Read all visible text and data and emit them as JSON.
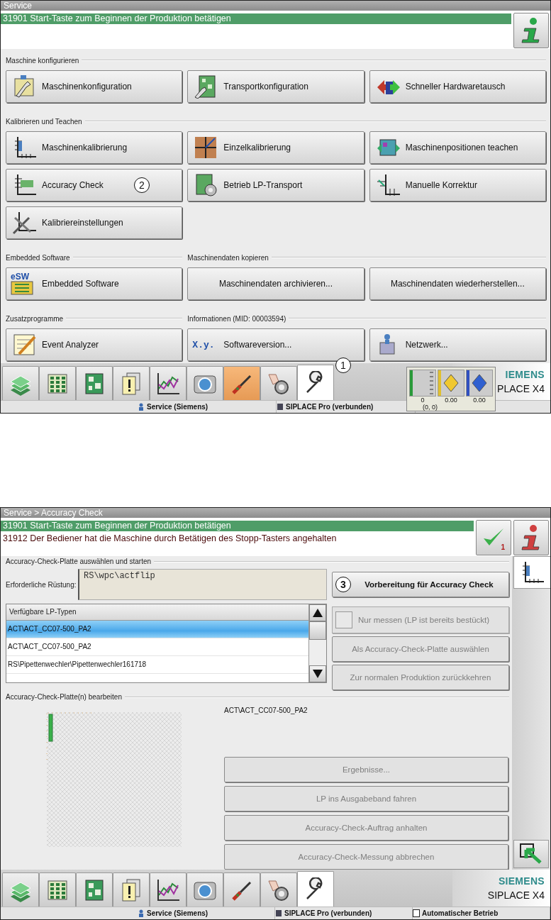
{
  "service_screen": {
    "title": "Service",
    "messages": [
      {
        "text": "31901 Start-Taste zum Beginnen der Produktion betätigen",
        "highlighted": true
      }
    ],
    "group_rows": [
      {
        "groups": [
          {
            "label": "Maschine konfigurieren",
            "buttons": [
              {
                "label": "Maschinenkonfiguration",
                "kind": "icon"
              },
              {
                "label": "Transportkonfiguration",
                "kind": "icon"
              },
              {
                "label": "Schneller Hardwaretausch",
                "kind": "icon"
              }
            ]
          }
        ]
      },
      {
        "groups": [
          {
            "label": "Kalibrieren und Teachen",
            "buttons": [
              {
                "label": "Maschinenkalibrierung",
                "kind": "icon"
              },
              {
                "label": "Einzelkalibrierung",
                "kind": "icon"
              },
              {
                "label": "Maschinenpositionen teachen",
                "kind": "icon"
              },
              {
                "label": "Accuracy Check",
                "kind": "icon",
                "callout": "2"
              },
              {
                "label": "Betrieb LP-Transport",
                "kind": "icon"
              },
              {
                "label": "Manuelle Korrektur",
                "kind": "icon"
              },
              {
                "label": "Kalibriereinstellungen",
                "kind": "icon"
              }
            ]
          }
        ]
      },
      {
        "groups": [
          {
            "label": "Embedded Software",
            "buttons": [
              {
                "label": "Embedded Software",
                "kind": "icon",
                "icon_text": "eSW"
              }
            ]
          },
          {
            "label": "Maschinendaten kopieren",
            "buttons": [
              {
                "label": "Maschinendaten archivieren...",
                "kind": "plain"
              },
              {
                "label": "Maschinendaten wiederherstellen...",
                "kind": "plain"
              }
            ]
          }
        ]
      },
      {
        "groups": [
          {
            "label": "Zusatzprogramme",
            "buttons": [
              {
                "label": "Event Analyzer",
                "kind": "icon"
              }
            ]
          },
          {
            "label": "Informationen (MID: 00003594)",
            "buttons": [
              {
                "label": "Softwareversion...",
                "kind": "icon",
                "icon_text": "X.y."
              },
              {
                "label": "Netzwerk...",
                "kind": "icon"
              }
            ]
          }
        ]
      }
    ],
    "nav_tabs": [
      {
        "selected": false,
        "highlighted": false
      },
      {
        "selected": false,
        "highlighted": false
      },
      {
        "selected": false,
        "highlighted": false
      },
      {
        "selected": false,
        "highlighted": false
      },
      {
        "selected": false,
        "highlighted": false
      },
      {
        "selected": false,
        "highlighted": false
      },
      {
        "selected": false,
        "highlighted": true
      },
      {
        "selected": false,
        "highlighted": false
      },
      {
        "selected": true,
        "highlighted": false
      }
    ],
    "nav_callout": "1",
    "meters": [
      {
        "reading": "0"
      },
      {
        "reading": "0.00"
      },
      {
        "reading": "0.00"
      }
    ],
    "meter_position": "(0, 0)",
    "brand": {
      "maker": "IEMENS",
      "model": "PLACE X4"
    },
    "status_bar": [
      "Service (Siemens)",
      "SIPLACE Pro (verbunden)"
    ]
  },
  "accuracy_check_screen": {
    "title": "Service > Accuracy Check",
    "messages": [
      {
        "text": "31901 Start-Taste zum Beginnen der Produktion betätigen",
        "highlighted": true
      },
      {
        "text": "31912 Der Bediener hat die Maschine durch Betätigen des Stopp-Tasters angehalten",
        "highlighted": false
      }
    ],
    "ack_count": "1",
    "select_group": "Accuracy-Check-Platte auswählen und starten",
    "required_setup": {
      "label": "Erforderliche Rüstung:",
      "value": "RS\\wpc\\actflip"
    },
    "prepare_button": {
      "label": "Vorbereitung für Accuracy Check",
      "callout": "3"
    },
    "lp_list": {
      "header": "Verfügbare LP-Typen",
      "rows": [
        {
          "text": "ACT\\ACT_CC07-500_PA2",
          "selected": true
        },
        {
          "text": "ACT\\ACT_CC07-500_PA2",
          "selected": false
        },
        {
          "text": "RS\\Pipettenwechler\\Pipettenwechler161718",
          "selected": false
        }
      ]
    },
    "measure_only": {
      "label": "Nur messen (LP ist bereits bestückt)",
      "checked": false,
      "disabled": true
    },
    "select_buttons": [
      {
        "label": "Als Accuracy-Check-Platte auswählen",
        "disabled": true
      },
      {
        "label": "Zur normalen Produktion zurückkehren",
        "disabled": true
      }
    ],
    "edit_group": "Accuracy-Check-Platte(n) bearbeiten",
    "plate_name": "ACT\\ACT_CC07-500_PA2",
    "edit_buttons": [
      {
        "label": "Ergebnisse...",
        "disabled": true
      },
      {
        "label": "LP ins Ausgabeband fahren",
        "disabled": true
      },
      {
        "label": "Accuracy-Check-Auftrag anhalten",
        "disabled": true
      },
      {
        "label": "Accuracy-Check-Messung abbrechen",
        "disabled": true
      }
    ],
    "nav_tabs": [
      {
        "selected": false,
        "highlighted": false
      },
      {
        "selected": false,
        "highlighted": false
      },
      {
        "selected": false,
        "highlighted": false
      },
      {
        "selected": false,
        "highlighted": false
      },
      {
        "selected": false,
        "highlighted": false
      },
      {
        "selected": false,
        "highlighted": false
      },
      {
        "selected": false,
        "highlighted": false
      },
      {
        "selected": false,
        "highlighted": false
      },
      {
        "selected": true,
        "highlighted": false
      }
    ],
    "brand": {
      "maker": "SIEMENS",
      "model": "SIPLACE X4"
    },
    "status_bar": [
      "Service (Siemens)",
      "SIPLACE Pro (verbunden)",
      "Automatischer Betrieb"
    ]
  }
}
